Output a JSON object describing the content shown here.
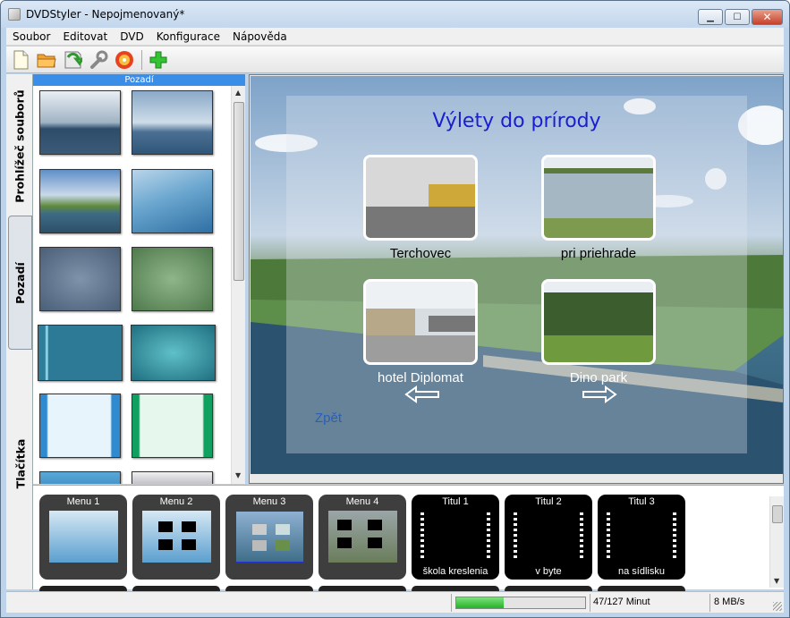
{
  "window": {
    "title": "DVDStyler - Nepojmenovaný*"
  },
  "menubar": [
    "Soubor",
    "Editovat",
    "DVD",
    "Konfigurace",
    "Nápověda"
  ],
  "toolbar": {
    "icons": [
      "new-file-icon",
      "open-folder-icon",
      "save-icon",
      "settings-wrench-icon",
      "burn-disc-icon",
      "add-icon"
    ]
  },
  "left_tabs": {
    "files": "Prohlížeč souborů",
    "backgrounds": "Pozadí",
    "buttons": "Tlačítka"
  },
  "panel": {
    "header": "Pozadí"
  },
  "menu_canvas": {
    "title": "Výlety do prírody",
    "buttons": [
      {
        "label": "Terchovec"
      },
      {
        "label": "pri priehrade"
      },
      {
        "label": "hotel Diplomat"
      },
      {
        "label": "Dino park"
      }
    ],
    "back_label": "Zpět"
  },
  "titleset": {
    "cards": [
      {
        "name": "Menu 1",
        "sub": ""
      },
      {
        "name": "Menu 2",
        "sub": ""
      },
      {
        "name": "Menu 3",
        "sub": ""
      },
      {
        "name": "Menu 4",
        "sub": ""
      },
      {
        "name": "Titul 1",
        "sub": "škola kreslenia"
      },
      {
        "name": "Titul 2",
        "sub": "v byte"
      },
      {
        "name": "Titul 3",
        "sub": "na sídlisku"
      }
    ]
  },
  "status": {
    "progress_fraction": 0.37,
    "minutes": "47/127 Minut",
    "speed": "8 MB/s"
  },
  "colors": {
    "accent": "#3b8ee8",
    "menu_title": "#1a1ed0",
    "progress": "#23b423"
  }
}
